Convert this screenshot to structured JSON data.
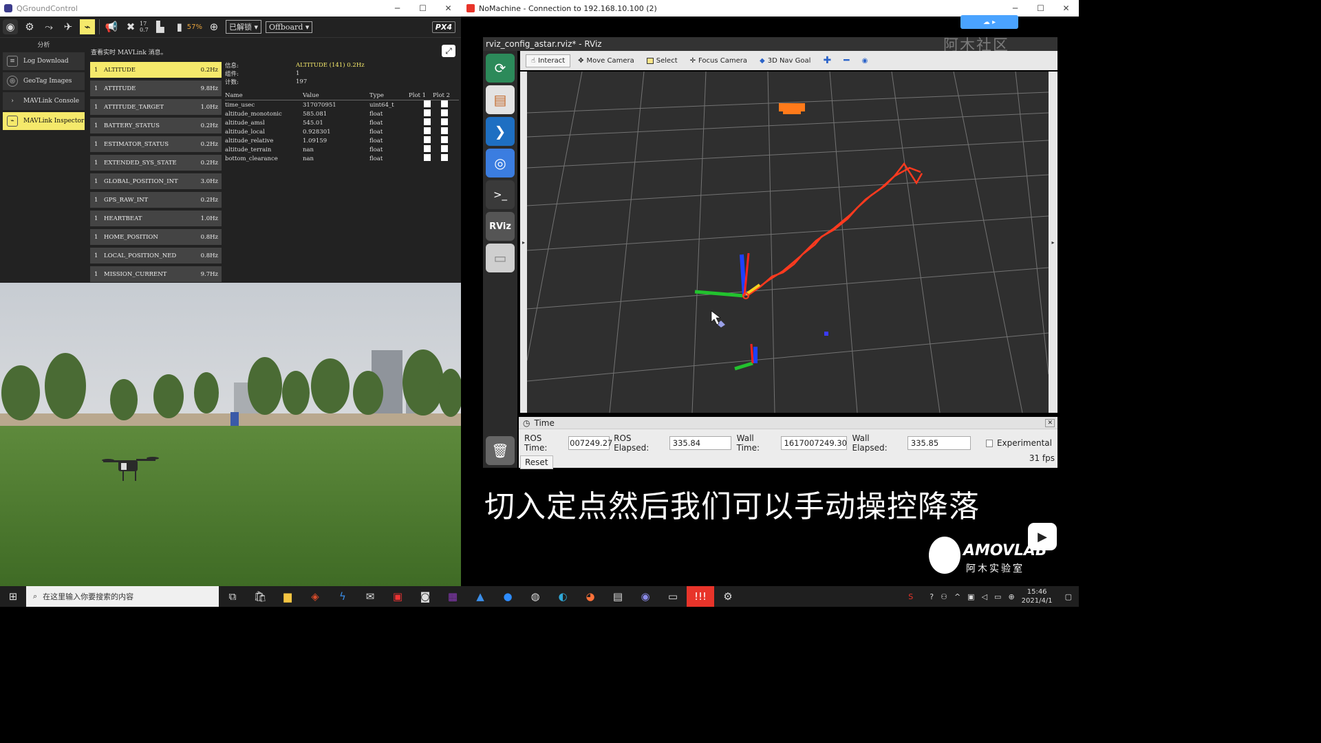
{
  "qgc": {
    "window_title": "QGroundControl",
    "toolbar": {
      "sats": "17",
      "hdop": "0.7",
      "battery": "57%",
      "arm_state": "已解锁",
      "flight_mode": "Offboard",
      "brand": "PX4"
    },
    "left_panel": {
      "header": "分析",
      "items": [
        "Log Download",
        "GeoTag Images",
        "MAVLink Console",
        "MAVLink Inspector"
      ]
    },
    "inspector": {
      "caption": "查看实时 MAVLink 消息。",
      "messages": [
        {
          "id": "1",
          "name": "ALTITUDE",
          "rate": "0.2Hz"
        },
        {
          "id": "1",
          "name": "ATTITUDE",
          "rate": "9.8Hz"
        },
        {
          "id": "1",
          "name": "ATTITUDE_TARGET",
          "rate": "1.0Hz"
        },
        {
          "id": "1",
          "name": "BATTERY_STATUS",
          "rate": "0.2Hz"
        },
        {
          "id": "1",
          "name": "ESTIMATOR_STATUS",
          "rate": "0.2Hz"
        },
        {
          "id": "1",
          "name": "EXTENDED_SYS_STATE",
          "rate": "0.2Hz"
        },
        {
          "id": "1",
          "name": "GLOBAL_POSITION_INT",
          "rate": "3.0Hz"
        },
        {
          "id": "1",
          "name": "GPS_RAW_INT",
          "rate": "0.2Hz"
        },
        {
          "id": "1",
          "name": "HEARTBEAT",
          "rate": "1.0Hz"
        },
        {
          "id": "1",
          "name": "HOME_POSITION",
          "rate": "0.8Hz"
        },
        {
          "id": "1",
          "name": "LOCAL_POSITION_NED",
          "rate": "0.8Hz"
        },
        {
          "id": "1",
          "name": "MISSION_CURRENT",
          "rate": "9.7Hz"
        }
      ],
      "detail": {
        "info_label": "信息:",
        "info_value": "ALTITUDE (141) 0.2Hz",
        "component_label": "组件:",
        "component_value": "1",
        "count_label": "计数:",
        "count_value": "197",
        "headers": {
          "name": "Name",
          "value": "Value",
          "type": "Type",
          "plot1": "Plot 1",
          "plot2": "Plot 2"
        },
        "fields": [
          {
            "name": "time_usec",
            "value": "317070951",
            "type": "uint64_t"
          },
          {
            "name": "altitude_monotonic",
            "value": "585.081",
            "type": "float"
          },
          {
            "name": "altitude_amsl",
            "value": "545.01",
            "type": "float"
          },
          {
            "name": "altitude_local",
            "value": "0.928301",
            "type": "float"
          },
          {
            "name": "altitude_relative",
            "value": "1.09159",
            "type": "float"
          },
          {
            "name": "altitude_terrain",
            "value": "nan",
            "type": "float"
          },
          {
            "name": "bottom_clearance",
            "value": "nan",
            "type": "float"
          }
        ]
      }
    }
  },
  "nomachine": {
    "window_title": "NoMachine - Connection to 192.168.10.100 (2)",
    "rviz_title": "rviz_config_astar.rviz* - RViz",
    "rviz_tools": [
      "Interact",
      "Move Camera",
      "Select",
      "Focus Camera",
      "3D Nav Goal"
    ],
    "time_panel": {
      "title": "Time",
      "ros_time_label": "ROS Time:",
      "ros_time": "007249.27",
      "ros_elapsed_label": "ROS Elapsed:",
      "ros_elapsed": "335.84",
      "wall_time_label": "Wall Time:",
      "wall_time": "1617007249.30",
      "wall_elapsed_label": "Wall Elapsed:",
      "wall_elapsed": "335.85",
      "experimental": "Experimental",
      "reset": "Reset",
      "fps": "31 fps"
    }
  },
  "subtitle": "切入定点然后我们可以手动操控降落",
  "watermark": {
    "brand": "AMOVLAB",
    "sub": "阿木实验室",
    "top": "阿木社区"
  },
  "taskbar": {
    "search_placeholder": "在这里输入你要搜索的内容",
    "time": "15:46",
    "date": "2021/4/1"
  },
  "colors": {
    "accent_yellow": "#f5e96b",
    "path_red": "#ff3a1f",
    "axis_green": "#22c22e",
    "axis_blue": "#1e40ff"
  }
}
